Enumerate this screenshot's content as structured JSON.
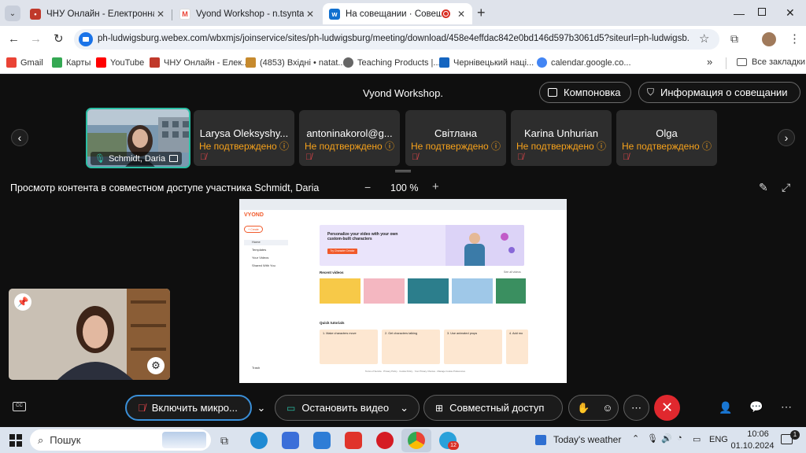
{
  "browser": {
    "tabs": [
      {
        "title": "ЧНУ Онлайн - Електронна пош",
        "active": false,
        "favicon_color": "#c0392b"
      },
      {
        "title": "Vyond Workshop - n.tsyntar@c",
        "active": false,
        "favicon_color": "#ea4335"
      },
      {
        "title": "На совещании · Совещань",
        "active": true,
        "favicon_color": "#1170cf"
      }
    ],
    "new_tab_label": "+",
    "url": "ph-ludwigsburg.webex.com/wbxmjs/joinservice/sites/ph-ludwigsburg/meeting/download/458e4effdac842e0bd146d597b3061d5?siteurl=ph-ludwigsb...",
    "bookmarks": [
      {
        "label": "Gmail",
        "color": "#ea4335"
      },
      {
        "label": "Карты",
        "color": "#34a853"
      },
      {
        "label": "YouTube",
        "color": "#ff0000"
      },
      {
        "label": "ЧНУ Онлайн - Елек...",
        "color": "#c0392b"
      },
      {
        "label": "(4853) Вхідні • natat...",
        "color": "#c68a2e"
      },
      {
        "label": "Teaching Products |...",
        "color": "#666666"
      },
      {
        "label": "Чернівецький наці...",
        "color": "#1565c0"
      },
      {
        "label": "calendar.google.co...",
        "color": "#4285f4"
      }
    ],
    "bookmarks_more": "»",
    "all_bookmarks": "Все закладки"
  },
  "webex": {
    "meeting_title": "Vyond Workshop.",
    "layout_button": "Компоновка",
    "info_button": "Информация о совещании",
    "self_name": "Schmidt, Daria",
    "participants": [
      {
        "name": "Larysa Oleksyshy...",
        "status": "Не подтверждено"
      },
      {
        "name": "antoninakorol@g...",
        "status": "Не подтверждено"
      },
      {
        "name": "Світлана",
        "status": "Не подтверждено"
      },
      {
        "name": "Karina Unhurian",
        "status": "Не подтверждено"
      },
      {
        "name": "Olga",
        "status": "Не подтверждено"
      }
    ],
    "share_caption": "Просмотр контента в совместном доступе участника Schmidt, Daria",
    "zoom_minus": "−",
    "zoom_level": "100 %",
    "zoom_plus": "+",
    "shared": {
      "logo": "VYOND",
      "create_button": "+ Create",
      "nav": [
        "Home",
        "Templates",
        "Your Videos",
        "Shared With You"
      ],
      "banner_title": "Personalize your video with your own custom-built characters",
      "banner_button": "Try Character Creator",
      "recent_videos_label": "Recent videos",
      "see_all": "See all videos",
      "quick_tutorials_label": "Quick tutorials",
      "tutorials": [
        "1. Make characters move",
        "2. Get characters talking",
        "3. Use animated props",
        "4. Add mo"
      ],
      "footer_links": "Terms of Service · Privacy Policy · Cookie Policy · Your Privacy Choices · Manage Cookie Preferences",
      "trash": "Trash"
    },
    "controls": {
      "mic_button": "Включить микро...",
      "video_button": "Остановить видео",
      "share_button": "Совместный доступ"
    }
  },
  "taskbar": {
    "search_label": "Пошук",
    "weather": "Today's weather",
    "lang": "ENG",
    "time": "10:06",
    "date": "01.10.2024",
    "notifications": "1",
    "chrome_badge": "12"
  }
}
